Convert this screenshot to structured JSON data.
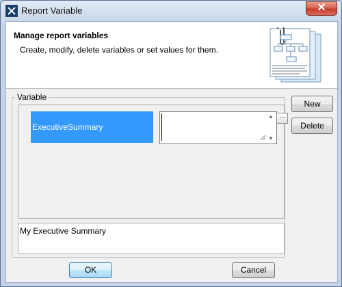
{
  "window": {
    "title": "Report Variable",
    "close_label": "✕"
  },
  "header": {
    "title": "Manage report variables",
    "description": "Create, modify, delete variables or set values for them."
  },
  "variable_group": {
    "label": "Variable",
    "rows": [
      {
        "name": "ExecutiveSummary",
        "value": ""
      }
    ],
    "ellipsis_label": "..."
  },
  "description_panel": {
    "text": "My Executive Summary"
  },
  "buttons": {
    "new_label": "New",
    "delete_label": "Delete",
    "ok_label": "OK",
    "cancel_label": "Cancel"
  },
  "icons": {
    "app": "app-icon",
    "close": "close-icon",
    "scroll_up": "chevron-up-icon",
    "scroll_down": "chevron-down-icon",
    "header": "report-document-icon"
  },
  "colors": {
    "selection": "#3399ff",
    "close_button": "#d55f4e"
  }
}
